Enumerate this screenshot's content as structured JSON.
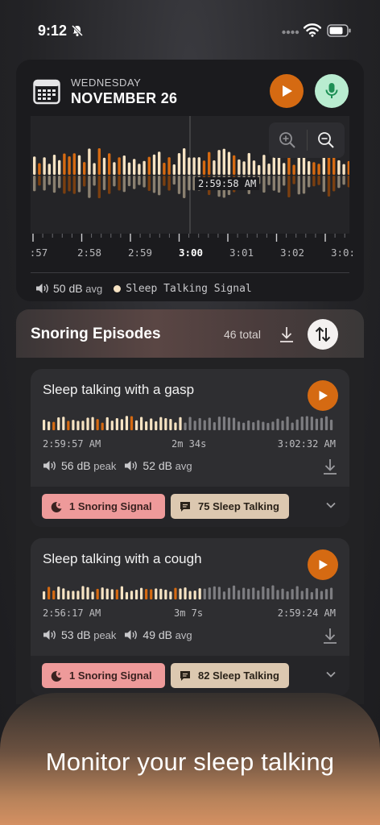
{
  "status_bar": {
    "time": "9:12"
  },
  "header": {
    "weekday": "WEDNESDAY",
    "date": "NOVEMBER 26"
  },
  "waveform": {
    "cursor_time": "2:59:58 AM",
    "ticks": [
      ":57",
      "2:58",
      "2:59",
      "3:00",
      "3:01",
      "3:02",
      "3:0:"
    ]
  },
  "legend": {
    "avg": "50 dB",
    "avg_unit": "avg",
    "signal": "Sleep Talking Signal"
  },
  "episodes": {
    "title": "Snoring Episodes",
    "total": "46 total",
    "items": [
      {
        "title": "Sleep talking with a gasp",
        "start": "2:59:57 AM",
        "duration": "2m 34s",
        "end": "3:02:32 AM",
        "peak": "56 dB",
        "peak_unit": "peak",
        "avg": "52 dB",
        "avg_unit": "avg",
        "snoring_chip": "1 Snoring Signal",
        "talking_chip": "75 Sleep Talking"
      },
      {
        "title": "Sleep talking with a cough",
        "start": "2:56:17 AM",
        "duration": "3m 7s",
        "end": "2:59:24 AM",
        "peak": "53 dB",
        "peak_unit": "peak",
        "avg": "49 dB",
        "avg_unit": "avg",
        "snoring_chip": "1 Snoring Signal",
        "talking_chip": "82 Sleep Talking"
      }
    ]
  },
  "banner": {
    "text": "Monitor your sleep talking"
  },
  "colors": {
    "accent": "#d56a12",
    "talk_bar": "#f6e3c3",
    "mic_bg": "#b9ecd0",
    "snore_chip": "#ee9a9a",
    "talk_chip": "#dcc8b0"
  }
}
